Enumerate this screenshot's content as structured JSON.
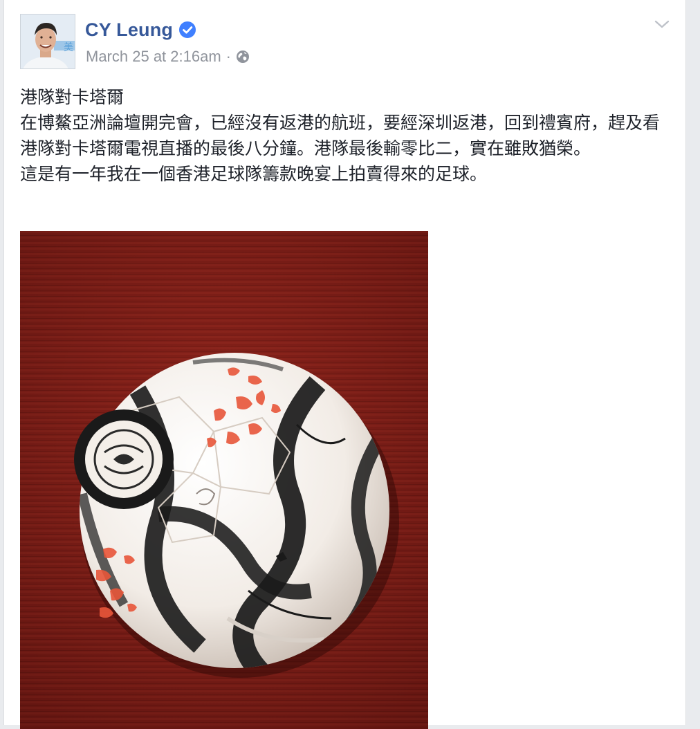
{
  "post": {
    "author": {
      "name": "CY Leung",
      "verified": true,
      "avatar_icon": "profile-photo"
    },
    "timestamp": "March 25 at 2:16am",
    "separator": "·",
    "privacy_icon": "globe-icon",
    "options_icon": "chevron-down-icon",
    "text_lines": [
      "港隊對卡塔爾",
      "在博鰲亞洲論壇開完會，已經沒有返港的航班，要經深圳返港，回到禮賓府，趕及看港隊對卡塔爾電視直播的最後八分鐘。港隊最後輸零比二，實在雖敗猶榮。",
      "這是有一年我在一個香港足球隊籌款晚宴上拍賣得來的足球。"
    ],
    "photo": {
      "subject": "signed football on red cloth"
    }
  },
  "colors": {
    "author_link": "#365899",
    "verified_badge": "#4080ff",
    "meta_text": "#90949c",
    "body_text": "#1d2129",
    "page_background": "#e9ebee"
  }
}
